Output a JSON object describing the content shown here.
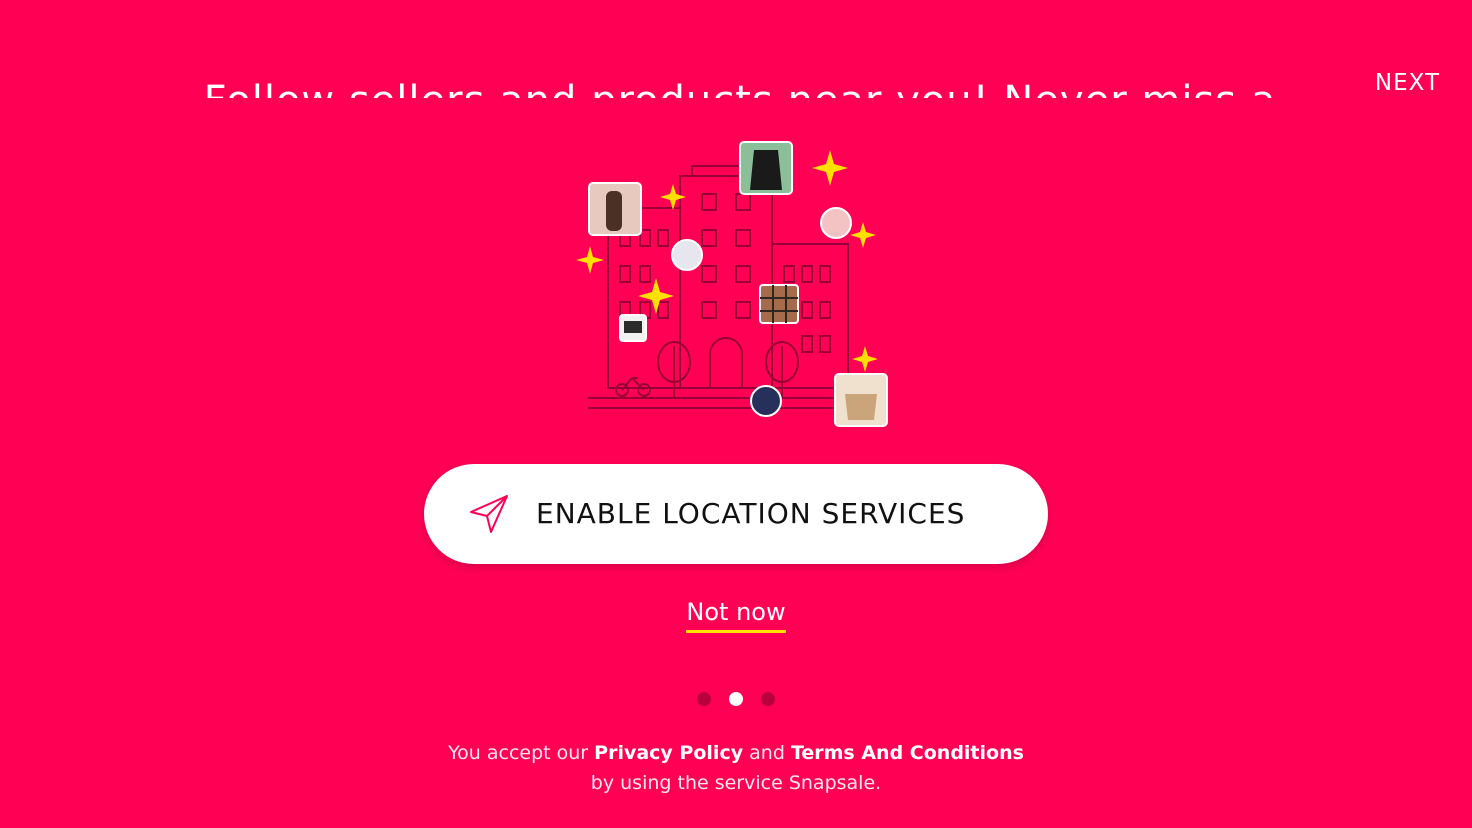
{
  "onboarding": {
    "headline": "Follow sellers and products near you! Never miss a",
    "next_label": "NEXT",
    "enable_location_label": "ENABLE LOCATION SERVICES",
    "not_now_label": "Not now",
    "pagination": {
      "current_page": 2,
      "total_pages": 3
    }
  },
  "legal": {
    "prefix": "You accept our",
    "privacy_link": "Privacy Policy",
    "and_text": "and",
    "terms_link": "Terms And Conditions",
    "suffix": "by using the service Snapsale."
  },
  "icons": {
    "enable_location": "location-arrow-icon",
    "sparkle": "sparkle-icon"
  },
  "colors": {
    "background": "#ff0055",
    "button_background": "#ffffff",
    "underline_accent": "#ffe000",
    "sparkle": "#ffe000",
    "dot_inactive": "#b8003f",
    "dot_active": "#ffffff"
  }
}
